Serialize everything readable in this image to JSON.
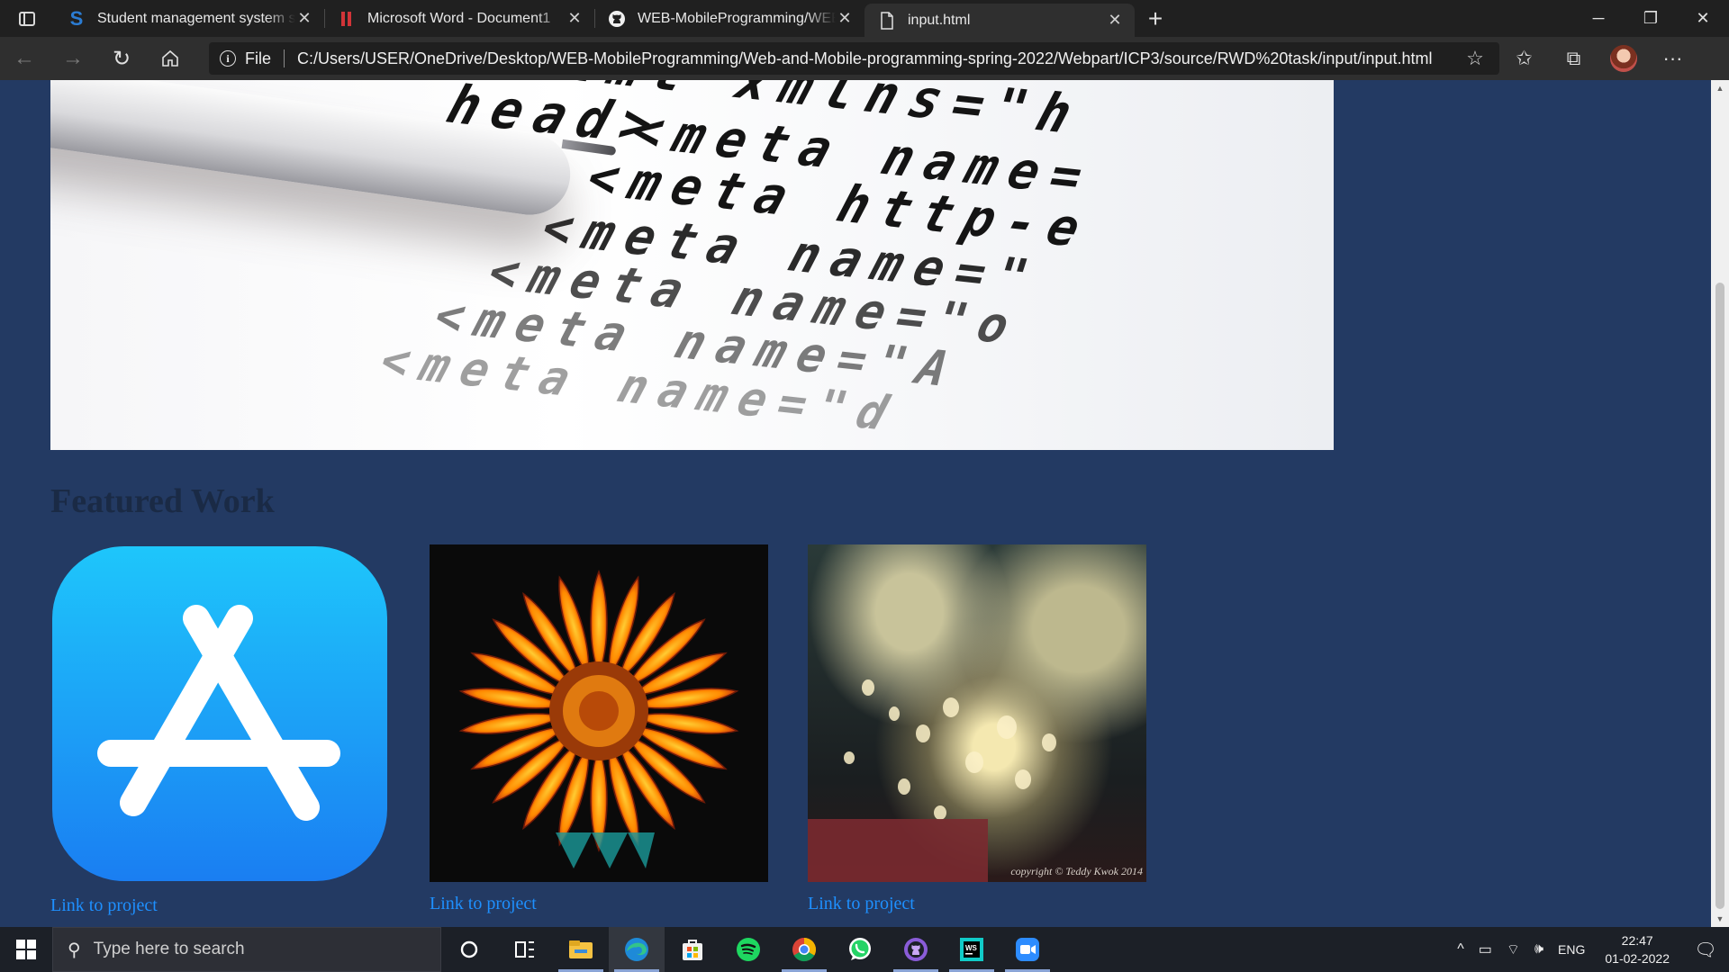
{
  "browser": {
    "tabs": [
      {
        "label": "Student management system srs",
        "favicon": "s-letter-icon",
        "active": false
      },
      {
        "label": "Microsoft Word - Document1",
        "favicon": "word-bars-icon",
        "active": false
      },
      {
        "label": "WEB-MobileProgramming/WEB-",
        "favicon": "github-icon",
        "active": false
      },
      {
        "label": "input.html",
        "favicon": "file-icon",
        "active": true
      }
    ],
    "address": {
      "scheme_label": "File",
      "url": "C:/Users/USER/OneDrive/Desktop/WEB-MobileProgramming/Web-and-Mobile-programming-spring-2022/Webpart/ICP3/source/RWD%20task/input/input.html"
    }
  },
  "page": {
    "hero_code_lines": [
      "<html xmlns=\"h",
      "head>",
      "<meta  name=",
      "<meta  http-e",
      "<meta  name=\"",
      "<meta  name=\"o",
      "<meta  name=\"A",
      "<meta  name=\"d"
    ],
    "section_title": "Featured Work",
    "projects": [
      {
        "image": "app-store-icon",
        "link_text": "Link to project"
      },
      {
        "image": "sunflower",
        "link_text": "Link to project"
      },
      {
        "image": "bokeh-lights",
        "link_text": "Link to project",
        "watermark": "copyright © Teddy Kwok 2014"
      }
    ],
    "colors": {
      "page_bg": "#233a63",
      "link": "#1e90ff",
      "title": "#1a2a45"
    }
  },
  "taskbar": {
    "search_placeholder": "Type here to search",
    "apps": [
      "cortana-icon",
      "task-view-icon",
      "file-explorer-icon",
      "edge-icon",
      "store-icon",
      "spotify-icon",
      "chrome-icon",
      "whatsapp-icon",
      "github-desktop-icon",
      "webstorm-icon",
      "zoom-icon"
    ],
    "tray": {
      "language": "ENG",
      "time": "22:47",
      "date": "01-02-2022"
    }
  }
}
